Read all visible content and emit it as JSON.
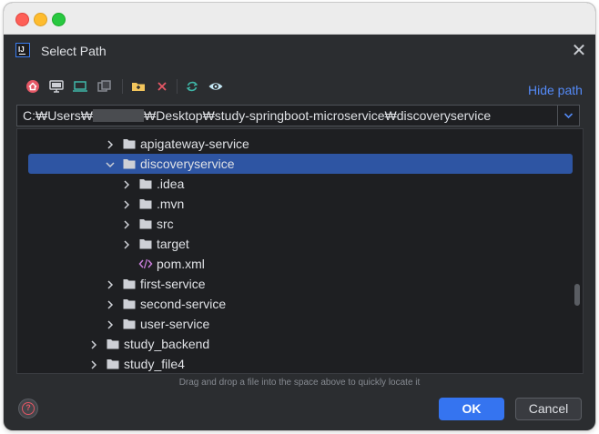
{
  "dialog": {
    "title": "Select Path"
  },
  "toolbar": {
    "icons": [
      "home-icon",
      "desktop-icon",
      "project-icon",
      "module-icon",
      "new-folder-icon",
      "delete-icon",
      "refresh-icon",
      "show-hidden-icon"
    ],
    "hide_path_label": "Hide path"
  },
  "path": {
    "prefix": "C:₩Users₩",
    "suffix": "₩Desktop₩study-springboot-microservice₩discoveryservice"
  },
  "tree": {
    "rows": [
      {
        "label": "apigateway-service",
        "type": "folder",
        "state": "collapsed"
      },
      {
        "label": "discoveryservice",
        "type": "folder",
        "state": "expanded",
        "selected": true
      },
      {
        "label": ".idea",
        "type": "folder",
        "state": "collapsed"
      },
      {
        "label": ".mvn",
        "type": "folder",
        "state": "collapsed"
      },
      {
        "label": "src",
        "type": "folder",
        "state": "collapsed"
      },
      {
        "label": "target",
        "type": "folder",
        "state": "collapsed"
      },
      {
        "label": "pom.xml",
        "type": "xml-file",
        "state": "leaf"
      },
      {
        "label": "first-service",
        "type": "folder",
        "state": "collapsed"
      },
      {
        "label": "second-service",
        "type": "folder",
        "state": "collapsed"
      },
      {
        "label": "user-service",
        "type": "folder",
        "state": "collapsed"
      },
      {
        "label": "study_backend",
        "type": "folder",
        "state": "collapsed"
      },
      {
        "label": "study_file4",
        "type": "folder",
        "state": "collapsed"
      }
    ]
  },
  "hint": "Drag and drop a file into the space above to quickly locate it",
  "buttons": {
    "ok": "OK",
    "cancel": "Cancel"
  },
  "colors": {
    "accent": "#3574f0",
    "selection": "#2e55a3",
    "link": "#548af7",
    "folder": "#ced0d6"
  }
}
